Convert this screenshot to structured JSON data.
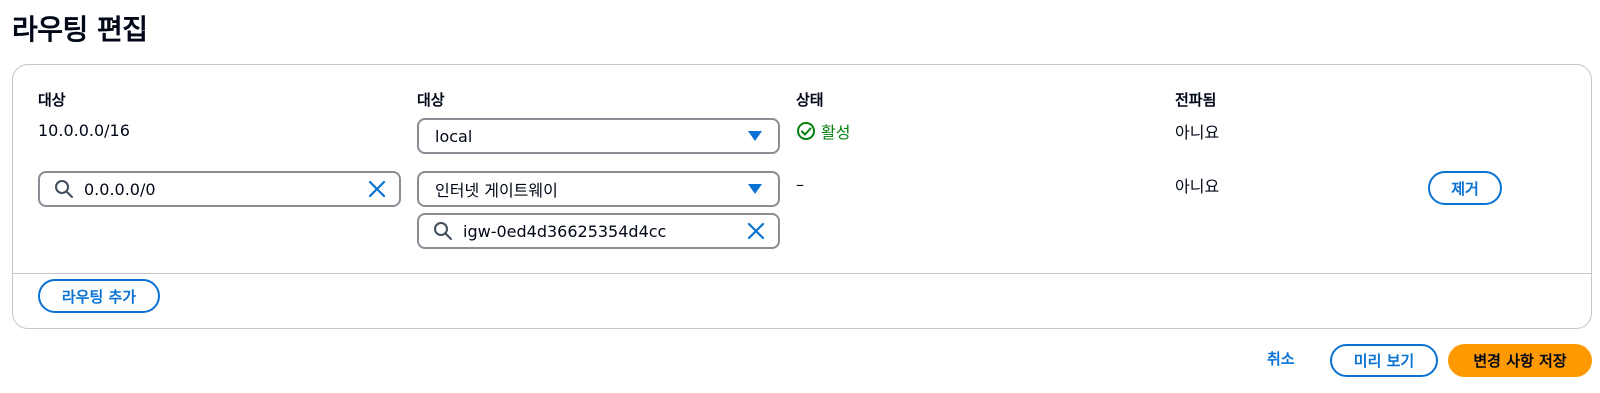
{
  "page": {
    "title": "라우팅 편집"
  },
  "columns": {
    "destination": "대상",
    "target": "대상",
    "status": "상태",
    "propagated": "전파됨"
  },
  "routes": [
    {
      "destination": "10.0.0.0/16",
      "target_select": "local",
      "status": "활성",
      "propagated": "아니요"
    },
    {
      "destination_search": "0.0.0.0/0",
      "target_select": "인터넷 게이트웨이",
      "target_search": "igw-0ed4d36625354d4cc",
      "status": "–",
      "propagated": "아니요",
      "remove_label": "제거"
    }
  ],
  "buttons": {
    "add_route": "라우팅 추가",
    "cancel": "취소",
    "preview": "미리 보기",
    "save": "변경 사항 저장"
  },
  "colors": {
    "link_blue": "#0972d3",
    "success_green": "#037f0c",
    "primary_orange": "#ff9900",
    "border_gray": "#8c8c94"
  },
  "icons": {
    "search": "search-icon",
    "clear": "close-icon",
    "caret": "caret-down-icon",
    "status_ok": "check-circle-icon"
  }
}
